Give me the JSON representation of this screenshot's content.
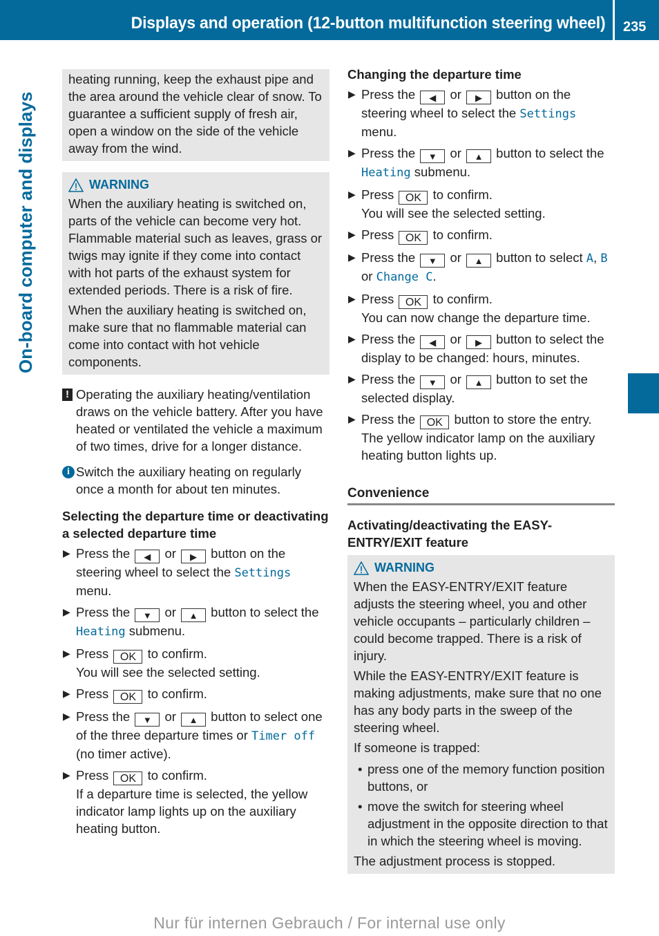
{
  "header": {
    "title": "Displays and operation (12-button multifunction steering wheel)",
    "page_number": "235"
  },
  "side_tab": {
    "label": "On-board computer and displays"
  },
  "colors": {
    "brand_blue": "#046a9c",
    "box_gray": "#e6e6e6"
  },
  "left": {
    "continued_box": "heating running, keep the exhaust pipe and the area around the vehicle clear of snow. To guarantee a sufficient supply of fresh air, open a window on the side of the vehicle away from the wind.",
    "warning": {
      "label": "WARNING",
      "p1": "When the auxiliary heating is switched on, parts of the vehicle can become very hot. Flammable material such as leaves, grass or twigs may ignite if they come into contact with hot parts of the exhaust system for extended periods. There is a risk of fire.",
      "p2": "When the auxiliary heating is switched on, make sure that no flammable material can come into contact with hot vehicle components."
    },
    "caution_note": "Operating the auxiliary heating/ventilation draws on the vehicle battery. After you have heated or ventilated the vehicle a maximum of two times, drive for a longer distance.",
    "info_note": "Switch the auxiliary heating on regularly once a month for about ten minutes.",
    "section_heading": "Selecting the departure time or deactivating a selected departure time",
    "steps": {
      "s1": {
        "pre": "Press the",
        "or": "or",
        "post": "button on the steering wheel to select the",
        "menu": "Settings",
        "end": "menu."
      },
      "s2": {
        "pre": "Press the",
        "or": "or",
        "post": "button to select the",
        "menu": "Heating",
        "end": "submenu."
      },
      "s3": {
        "pre": "Press",
        "post": "to confirm.",
        "result": "You will see the selected setting."
      },
      "s4": {
        "pre": "Press",
        "post": "to confirm."
      },
      "s5": {
        "pre": "Press the",
        "or": "or",
        "post": "button to select one of the three departure times or",
        "menu": "Timer off",
        "end": "(no timer active)."
      },
      "s6": {
        "pre": "Press",
        "post": "to confirm.",
        "result": "If a departure time is selected, the yellow indicator lamp lights up on the auxiliary heating button."
      }
    }
  },
  "keys": {
    "left": "◀",
    "right": "▶",
    "down": "▼",
    "up": "▲",
    "ok": "OK"
  },
  "right": {
    "section_heading": "Changing the departure time",
    "steps": {
      "s1": {
        "pre": "Press the",
        "or": "or",
        "post": "button on the steering wheel to select the",
        "menu": "Settings",
        "end": "menu."
      },
      "s2": {
        "pre": "Press the",
        "or": "or",
        "post": "button to select the",
        "menu": "Heating",
        "end": "submenu."
      },
      "s3": {
        "pre": "Press",
        "post": "to confirm.",
        "result": "You will see the selected setting."
      },
      "s4": {
        "pre": "Press",
        "post": "to confirm."
      },
      "s5": {
        "pre": "Press the",
        "or": "or",
        "post": "button to select",
        "opt_a": "A",
        "comma": ",",
        "opt_b": "B",
        "or2": "or",
        "opt_c": "Change C",
        "end": "."
      },
      "s6": {
        "pre": "Press",
        "post": "to confirm.",
        "result": "You can now change the departure time."
      },
      "s7": {
        "pre": "Press the",
        "or": "or",
        "post": "button to select the display to be changed: hours, minutes."
      },
      "s8": {
        "pre": "Press the",
        "or": "or",
        "post": "button to set the selected display."
      },
      "s9": {
        "pre": "Press the",
        "post": "button to store the entry.",
        "result": "The yellow indicator lamp on the auxiliary heating button lights up."
      }
    },
    "convenience_heading": "Convenience",
    "easy_entry_heading": "Activating/deactivating the EASY-ENTRY/EXIT feature",
    "warning": {
      "label": "WARNING",
      "p1": "When the EASY-ENTRY/EXIT feature adjusts the steering wheel, you and other vehicle occupants – particularly children – could become trapped. There is a risk of injury.",
      "p2": "While the EASY-ENTRY/EXIT feature is making adjustments, make sure that no one has any body parts in the sweep of the steering wheel.",
      "p3": "If someone is trapped:",
      "bullets": [
        "press one of the memory function position buttons, or",
        "move the switch for steering wheel adjustment in the opposite direction to that in which the steering wheel is moving."
      ],
      "p4": "The adjustment process is stopped."
    }
  },
  "footer": {
    "watermark": "Nur für internen Gebrauch / For internal use only"
  }
}
